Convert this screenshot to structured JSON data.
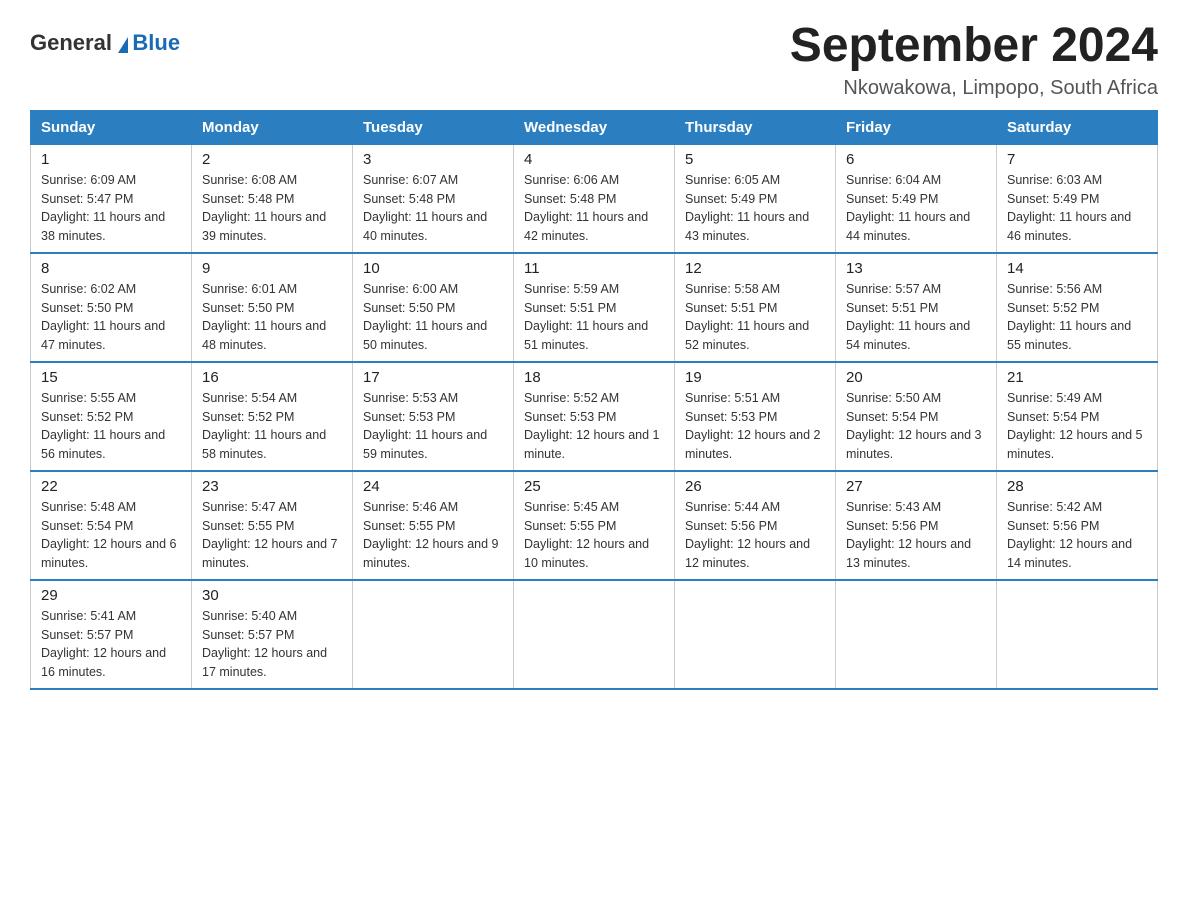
{
  "logo": {
    "general": "General",
    "blue": "Blue"
  },
  "title": "September 2024",
  "location": "Nkowakowa, Limpopo, South Africa",
  "days_of_week": [
    "Sunday",
    "Monday",
    "Tuesday",
    "Wednesday",
    "Thursday",
    "Friday",
    "Saturday"
  ],
  "weeks": [
    [
      {
        "day": "1",
        "sunrise": "6:09 AM",
        "sunset": "5:47 PM",
        "daylight": "11 hours and 38 minutes."
      },
      {
        "day": "2",
        "sunrise": "6:08 AM",
        "sunset": "5:48 PM",
        "daylight": "11 hours and 39 minutes."
      },
      {
        "day": "3",
        "sunrise": "6:07 AM",
        "sunset": "5:48 PM",
        "daylight": "11 hours and 40 minutes."
      },
      {
        "day": "4",
        "sunrise": "6:06 AM",
        "sunset": "5:48 PM",
        "daylight": "11 hours and 42 minutes."
      },
      {
        "day": "5",
        "sunrise": "6:05 AM",
        "sunset": "5:49 PM",
        "daylight": "11 hours and 43 minutes."
      },
      {
        "day": "6",
        "sunrise": "6:04 AM",
        "sunset": "5:49 PM",
        "daylight": "11 hours and 44 minutes."
      },
      {
        "day": "7",
        "sunrise": "6:03 AM",
        "sunset": "5:49 PM",
        "daylight": "11 hours and 46 minutes."
      }
    ],
    [
      {
        "day": "8",
        "sunrise": "6:02 AM",
        "sunset": "5:50 PM",
        "daylight": "11 hours and 47 minutes."
      },
      {
        "day": "9",
        "sunrise": "6:01 AM",
        "sunset": "5:50 PM",
        "daylight": "11 hours and 48 minutes."
      },
      {
        "day": "10",
        "sunrise": "6:00 AM",
        "sunset": "5:50 PM",
        "daylight": "11 hours and 50 minutes."
      },
      {
        "day": "11",
        "sunrise": "5:59 AM",
        "sunset": "5:51 PM",
        "daylight": "11 hours and 51 minutes."
      },
      {
        "day": "12",
        "sunrise": "5:58 AM",
        "sunset": "5:51 PM",
        "daylight": "11 hours and 52 minutes."
      },
      {
        "day": "13",
        "sunrise": "5:57 AM",
        "sunset": "5:51 PM",
        "daylight": "11 hours and 54 minutes."
      },
      {
        "day": "14",
        "sunrise": "5:56 AM",
        "sunset": "5:52 PM",
        "daylight": "11 hours and 55 minutes."
      }
    ],
    [
      {
        "day": "15",
        "sunrise": "5:55 AM",
        "sunset": "5:52 PM",
        "daylight": "11 hours and 56 minutes."
      },
      {
        "day": "16",
        "sunrise": "5:54 AM",
        "sunset": "5:52 PM",
        "daylight": "11 hours and 58 minutes."
      },
      {
        "day": "17",
        "sunrise": "5:53 AM",
        "sunset": "5:53 PM",
        "daylight": "11 hours and 59 minutes."
      },
      {
        "day": "18",
        "sunrise": "5:52 AM",
        "sunset": "5:53 PM",
        "daylight": "12 hours and 1 minute."
      },
      {
        "day": "19",
        "sunrise": "5:51 AM",
        "sunset": "5:53 PM",
        "daylight": "12 hours and 2 minutes."
      },
      {
        "day": "20",
        "sunrise": "5:50 AM",
        "sunset": "5:54 PM",
        "daylight": "12 hours and 3 minutes."
      },
      {
        "day": "21",
        "sunrise": "5:49 AM",
        "sunset": "5:54 PM",
        "daylight": "12 hours and 5 minutes."
      }
    ],
    [
      {
        "day": "22",
        "sunrise": "5:48 AM",
        "sunset": "5:54 PM",
        "daylight": "12 hours and 6 minutes."
      },
      {
        "day": "23",
        "sunrise": "5:47 AM",
        "sunset": "5:55 PM",
        "daylight": "12 hours and 7 minutes."
      },
      {
        "day": "24",
        "sunrise": "5:46 AM",
        "sunset": "5:55 PM",
        "daylight": "12 hours and 9 minutes."
      },
      {
        "day": "25",
        "sunrise": "5:45 AM",
        "sunset": "5:55 PM",
        "daylight": "12 hours and 10 minutes."
      },
      {
        "day": "26",
        "sunrise": "5:44 AM",
        "sunset": "5:56 PM",
        "daylight": "12 hours and 12 minutes."
      },
      {
        "day": "27",
        "sunrise": "5:43 AM",
        "sunset": "5:56 PM",
        "daylight": "12 hours and 13 minutes."
      },
      {
        "day": "28",
        "sunrise": "5:42 AM",
        "sunset": "5:56 PM",
        "daylight": "12 hours and 14 minutes."
      }
    ],
    [
      {
        "day": "29",
        "sunrise": "5:41 AM",
        "sunset": "5:57 PM",
        "daylight": "12 hours and 16 minutes."
      },
      {
        "day": "30",
        "sunrise": "5:40 AM",
        "sunset": "5:57 PM",
        "daylight": "12 hours and 17 minutes."
      },
      null,
      null,
      null,
      null,
      null
    ]
  ],
  "labels": {
    "sunrise": "Sunrise:",
    "sunset": "Sunset:",
    "daylight": "Daylight:"
  }
}
